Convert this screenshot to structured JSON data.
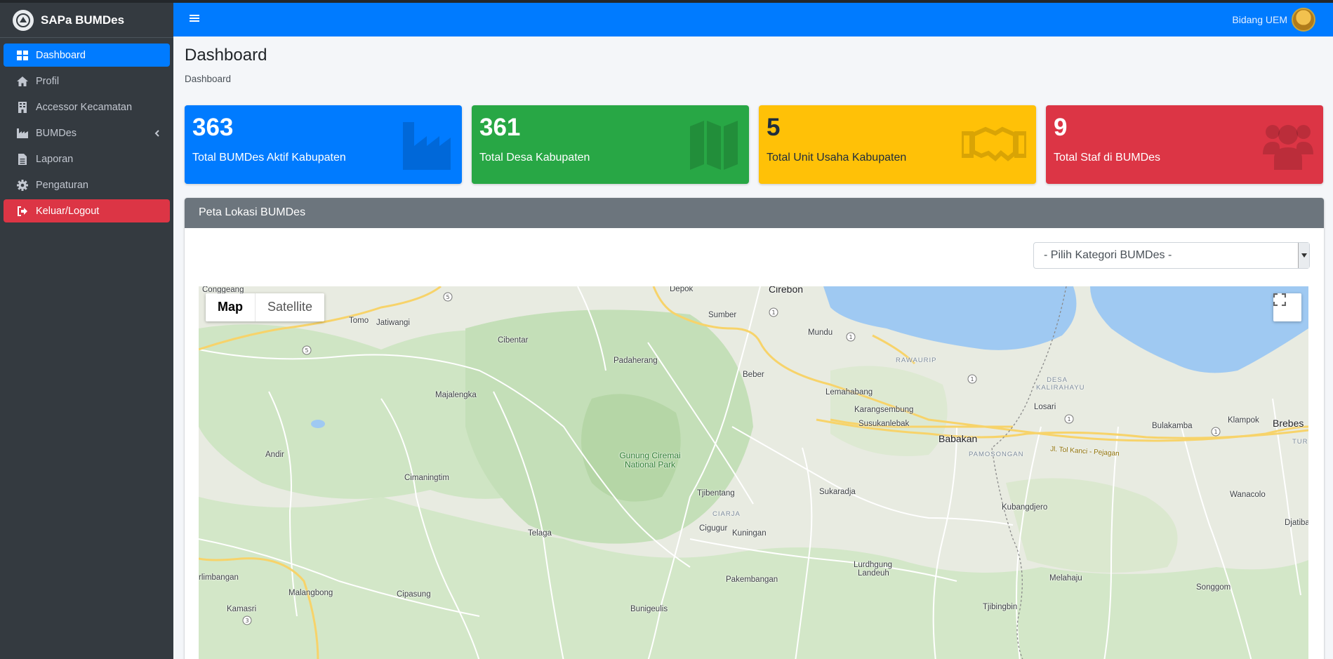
{
  "app": {
    "brand": "SAPa BUMDes"
  },
  "sidebar": {
    "items": [
      {
        "label": "Dashboard",
        "icon": "th-large-icon"
      },
      {
        "label": "Profil",
        "icon": "home-icon"
      },
      {
        "label": "Accessor Kecamatan",
        "icon": "building-icon"
      },
      {
        "label": "BUMDes",
        "icon": "industry-icon"
      },
      {
        "label": "Laporan",
        "icon": "file-icon"
      },
      {
        "label": "Pengaturan",
        "icon": "gear-icon"
      },
      {
        "label": "Keluar/Logout",
        "icon": "sign-out-icon"
      }
    ]
  },
  "header": {
    "user_name": "Bidang UEM"
  },
  "page": {
    "title": "Dashboard",
    "breadcrumb": "Dashboard"
  },
  "stats": [
    {
      "value": "363",
      "label": "Total BUMDes Aktif Kabupaten",
      "color": "#007bff",
      "icon": "industry-icon"
    },
    {
      "value": "361",
      "label": "Total Desa Kabupaten",
      "color": "#28a745",
      "icon": "map-icon"
    },
    {
      "value": "5",
      "label": "Total Unit Usaha Kabupaten",
      "color": "#ffc107",
      "icon": "handshake-icon"
    },
    {
      "value": "9",
      "label": "Total Staf di BUMDes",
      "color": "#dc3545",
      "icon": "users-icon"
    }
  ],
  "map_panel": {
    "title": "Peta Lokasi BUMDes",
    "select_value": "- Pilih Kategori BUMDes -",
    "map_type": {
      "map": "Map",
      "satellite": "Satellite"
    },
    "places": {
      "congdeang": "Conggeang",
      "tomo": "Tomo",
      "jatiwangi": "Jatiwangi",
      "cibentar": "Cibentar",
      "depok": "Depok",
      "cirebon": "Cirebon",
      "sumber": "Sumber",
      "mundu": "Mundu",
      "padaherang": "Padaherang",
      "beber": "Beber",
      "rawaurip": "RAWAURIP",
      "desa_kalirahayu": "DESA KALIRAHAYU",
      "majalengka": "Majalengka",
      "lemahabang": "Lemahabang",
      "karangsembung": "Karangsembung",
      "susukanlebak": "Susukanlebak",
      "losari": "Losari",
      "babakan": "Babakan",
      "bulakamba": "Bulakamba",
      "klampok": "Klampok",
      "brebes": "Brebes",
      "pamosongan": "PAMOSONGAN",
      "tol": "Jl. Tol Kanci - Pejagan",
      "andir": "Andir",
      "park": "Gunung Ciremai National Park",
      "cimaningtim": "Cimaningtim",
      "tjibentang": "Tjibentang",
      "sukaradja": "Sukaradja",
      "wanacolo": "Wanacolo",
      "kubangdjero": "Kubangdjero",
      "ciarja": "CIARJA",
      "telaga": "Telaga",
      "cigugur": "Cigugur",
      "kuningan": "Kuningan",
      "djatibara": "Djatibara",
      "lurdhgung": "Lurdhgung",
      "landeuh": "Landeuh",
      "rlimbangan": "rlimbangan",
      "malangbong": "Malangbong",
      "cipasung": "Cipasung",
      "pakembangan": "Pakembangan",
      "melahaju": "Melahaju",
      "songgom": "Songgom",
      "kamasri": "Kamasri",
      "bunigeulis": "Bunigeulis",
      "tjibingbin": "Tjibingbin",
      "tur": "TUR"
    },
    "shields": [
      "5",
      "5",
      "1",
      "1",
      "1",
      "1",
      "1",
      "3"
    ]
  }
}
